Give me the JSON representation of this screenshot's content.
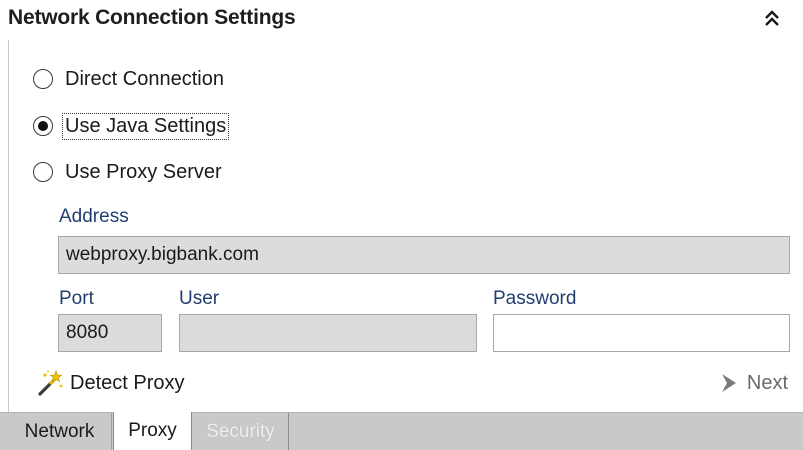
{
  "header": {
    "title": "Network Connection Settings",
    "collapse_icon": "double-chevron-up-icon"
  },
  "connection": {
    "options": [
      {
        "label": "Direct Connection",
        "selected": false
      },
      {
        "label": "Use Java Settings",
        "selected": true
      },
      {
        "label": "Use Proxy Server",
        "selected": false
      }
    ]
  },
  "proxy": {
    "address_label": "Address",
    "address_value": "webproxy.bigbank.com",
    "port_label": "Port",
    "port_value": "8080",
    "user_label": "User",
    "user_value": "",
    "password_label": "Password",
    "password_value": ""
  },
  "actions": {
    "detect_label": "Detect Proxy",
    "detect_icon": "magic-wand-icon",
    "next_label": "Next",
    "next_icon": "chevron-right-icon"
  },
  "tabs": [
    {
      "label": "Network",
      "active": false,
      "enabled": true
    },
    {
      "label": "Proxy",
      "active": true,
      "enabled": true
    },
    {
      "label": "Security",
      "active": false,
      "enabled": false
    }
  ],
  "colors": {
    "field_label": "#233e6e",
    "readonly_field_bg": "#dcdcdc",
    "tabbar_bg": "#c9c9c9"
  }
}
